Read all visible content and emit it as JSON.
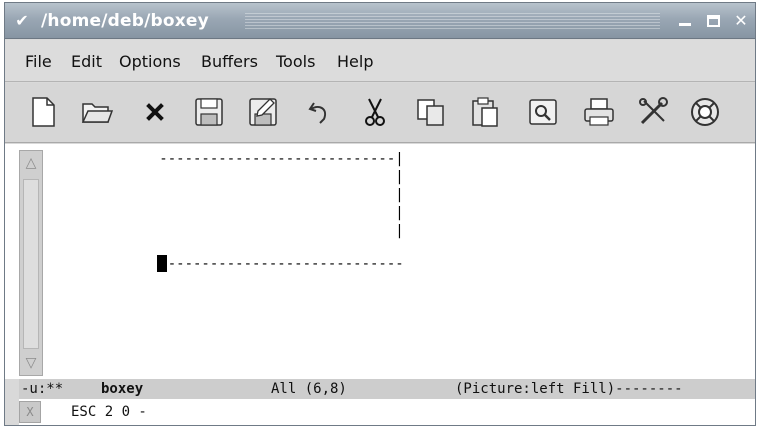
{
  "window": {
    "title": "/home/deb/boxey",
    "menu_glyph": "✔",
    "controls": [
      "minimize",
      "maximize",
      "close"
    ]
  },
  "menubar": {
    "items": [
      "File",
      "Edit",
      "Options",
      "Buffers",
      "Tools",
      "Help"
    ]
  },
  "toolbar": {
    "buttons": [
      {
        "name": "new-file",
        "icon": "new-file-icon"
      },
      {
        "name": "open-folder",
        "icon": "folder-open-icon"
      },
      {
        "name": "close-buffer",
        "icon": "close-x-icon"
      },
      {
        "name": "save",
        "icon": "floppy-disk-icon"
      },
      {
        "name": "save-as",
        "icon": "floppy-edit-icon"
      },
      {
        "name": "undo",
        "icon": "undo-icon"
      },
      {
        "name": "cut",
        "icon": "scissors-icon"
      },
      {
        "name": "copy",
        "icon": "copy-icon"
      },
      {
        "name": "paste",
        "icon": "paste-icon"
      },
      {
        "name": "search",
        "icon": "search-document-icon"
      },
      {
        "name": "print",
        "icon": "printer-icon"
      },
      {
        "name": "customize",
        "icon": "tools-icon"
      },
      {
        "name": "help",
        "icon": "lifebuoy-icon"
      }
    ]
  },
  "editor": {
    "lines": [
      "          ----------------------------|",
      "                                      |",
      "                                      |",
      "                                      |",
      "                                      |",
      "          -----------------------------"
    ]
  },
  "modeline": {
    "status": "-u:**",
    "buffer": "boxey",
    "position": "All (6,8)",
    "modes": "(Picture:left Fill)--------"
  },
  "minibuffer": {
    "text": "ESC 2 0 -"
  },
  "colors": {
    "titlebar": "#9aa7b4",
    "background": "#d9d9d9",
    "editor_bg": "#ffffff"
  }
}
